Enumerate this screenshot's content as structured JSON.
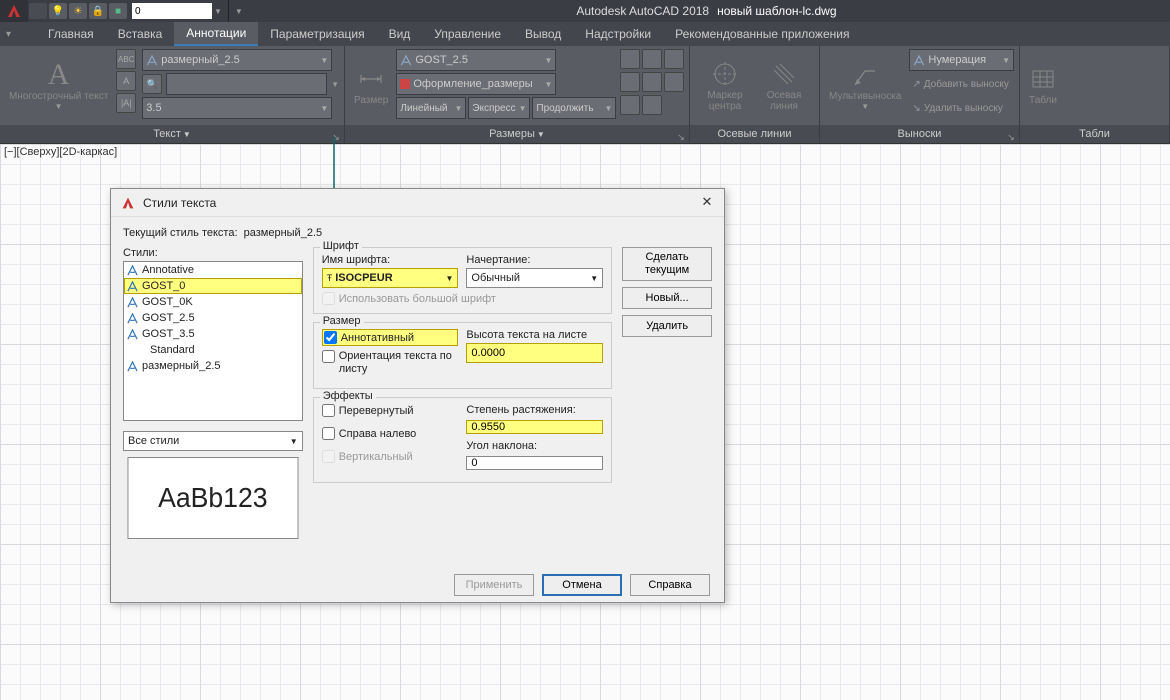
{
  "app": {
    "name": "Autodesk AutoCAD 2018",
    "doc": "новый шаблон-lc.dwg",
    "searchValue": "0"
  },
  "tabs": {
    "items": [
      "Главная",
      "Вставка",
      "Аннотации",
      "Параметризация",
      "Вид",
      "Управление",
      "Вывод",
      "Надстройки",
      "Рекомендованные приложения"
    ],
    "activeIndex": 2
  },
  "ribbon": {
    "textPanel": {
      "title": "Текст",
      "bigBtn": "Многострочный текст",
      "styleDD": "размерный_2.5",
      "sizeDD": "3.5"
    },
    "dimPanel": {
      "title": "Размеры",
      "bigBtn": "Размер",
      "styleDD": "GOST_2.5",
      "layerDD": "Оформление_размеры",
      "linearLabel": "Линейный",
      "expressLabel": "Экспресс",
      "contLabel": "Продолжить"
    },
    "axesPanel": {
      "title": "Осевые линии",
      "btn1": "Маркер центра",
      "btn2": "Осевая линия"
    },
    "leadPanel": {
      "title": "Выноски",
      "bigBtn": "Мультивыноска",
      "styleDD": "Нумерация",
      "addLabel": "Добавить выноску",
      "remLabel": "Удалить выноску"
    },
    "tablePanel": {
      "title": "Табли",
      "bigBtn": "Табли"
    }
  },
  "viewLabel": "[−][Сверху][2D-каркас]",
  "dialog": {
    "title": "Стили текста",
    "currentLabel": "Текущий стиль текста:",
    "currentValue": "размерный_2.5",
    "stylesLabel": "Стили:",
    "styles": [
      {
        "name": "Annotative",
        "ann": true
      },
      {
        "name": "GOST_0",
        "ann": true,
        "sel": true
      },
      {
        "name": "GOST_0K",
        "ann": true
      },
      {
        "name": "GOST_2.5",
        "ann": true
      },
      {
        "name": "GOST_3.5",
        "ann": true
      },
      {
        "name": "Standard",
        "ann": false
      },
      {
        "name": "размерный_2.5",
        "ann": true
      }
    ],
    "filter": "Все стили",
    "preview": "AaBb123",
    "font": {
      "group": "Шрифт",
      "nameLabel": "Имя шрифта:",
      "nameValue": "ISOCPEUR",
      "styleLabel": "Начертание:",
      "styleValue": "Обычный",
      "bigfont": "Использовать большой шрифт"
    },
    "size": {
      "group": "Размер",
      "annotative": "Аннотативный",
      "orient": "Ориентация текста по листу",
      "heightLabel": "Высота текста на листе",
      "heightValue": "0.0000"
    },
    "effects": {
      "group": "Эффекты",
      "upside": "Перевернутый",
      "backward": "Справа налево",
      "vertical": "Вертикальный",
      "widthLabel": "Степень растяжения:",
      "widthValue": "0.9550",
      "obliqueLabel": "Угол наклона:",
      "obliqueValue": "0"
    },
    "buttons": {
      "setcurrent": "Сделать текущим",
      "new": "Новый...",
      "delete": "Удалить",
      "apply": "Применить",
      "cancel": "Отмена",
      "help": "Справка"
    }
  }
}
